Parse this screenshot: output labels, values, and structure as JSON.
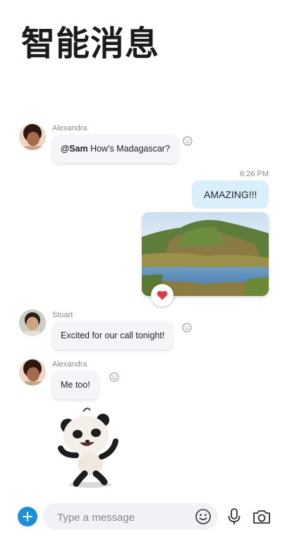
{
  "header": {
    "title": "智能消息"
  },
  "messages": {
    "m1": {
      "sender": "Alexandra",
      "mention": "@Sam",
      "text": " How's Madagascar?"
    },
    "m2": {
      "time": "6:26 PM",
      "text": "AMAZING!!!"
    },
    "m3": {
      "sender": "Stuart",
      "text": "Excited for our call tonight!"
    },
    "m4": {
      "sender": "Alexandra",
      "text": "Me too!"
    }
  },
  "composer": {
    "placeholder": "Type a message"
  },
  "icons": {
    "add": "plus-icon",
    "emoji": "smiley-icon",
    "mic": "microphone-icon",
    "camera": "camera-icon",
    "reaction": "heart-icon",
    "react_add": "smiley-icon"
  },
  "colors": {
    "accent": "#1a90dc",
    "outgoing": "#d9f0fc",
    "incoming": "#f3f5f8",
    "heart": "#e8353e"
  }
}
